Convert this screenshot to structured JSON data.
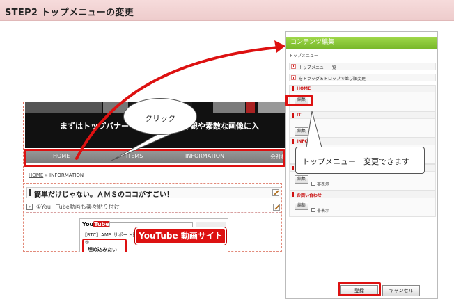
{
  "step_header": {
    "title": "STEP2 トップメニューの変更"
  },
  "site": {
    "banner_text": "まずはトップバナー　　　　　店の外観や素敵な画像に入",
    "nav": [
      "HOME",
      "ITEMS",
      "INFORMATION",
      "会社概"
    ],
    "breadcrumb": {
      "home": "HOME",
      "sep": "»",
      "current": "INFORMATION"
    },
    "headline": "簡単だけじゃない。ＡＭＳのココがすごい！",
    "expand": "»",
    "sub_text": "①You　Tube動画も楽々貼り付け",
    "youtube": {
      "logo_you": "You",
      "logo_tube": "Tube",
      "title": "【RTC】AMS サポート動",
      "num": "①",
      "embed_label": "埋め込みたい"
    },
    "youtube_badge": "YouTube 動画サイト"
  },
  "bubbles": {
    "click": "クリック",
    "menu": "トップメニュー　変更できます"
  },
  "panel": {
    "title": "コンテンツ編集",
    "subtitle": "トップメニュー",
    "list_label": "トップメニュー一覧",
    "drag_label": "をドラッグ＆ドロップで並び順変更",
    "blocks": [
      {
        "label": "HOME",
        "edit": "編集",
        "hide": ""
      },
      {
        "label": "IT",
        "edit": "編集",
        "hide": ""
      },
      {
        "label": "INFORM",
        "edit": "編集",
        "hide": ""
      },
      {
        "label": "",
        "edit": "編集",
        "hide": "非表示"
      },
      {
        "label": "お問い合わせ",
        "edit": "編集",
        "hide": "非表示"
      }
    ],
    "register": "登録",
    "cancel": "キャンセル"
  },
  "colors": {
    "accent_red": "#dd1111",
    "panel_green": "#8cc63f",
    "header_pink": "#f3d2d2"
  }
}
